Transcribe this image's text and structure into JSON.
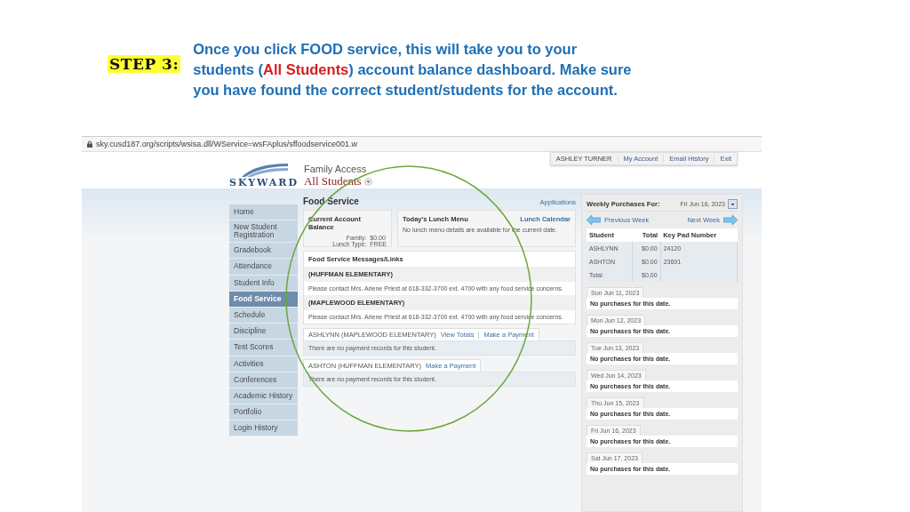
{
  "instruction": {
    "step": "STEP 3:",
    "parts": [
      {
        "text": "Once you click FOOD service, this will take you to your students (",
        "kind": "plain"
      },
      {
        "text": "All Students",
        "kind": "highlight"
      },
      {
        "text": ") account balance dashboard. Make sure you have found the correct student/students for the account.",
        "kind": "plain"
      }
    ]
  },
  "browser": {
    "url": "sky.cusd187.org/scripts/wsisa.dll/WService=wsFAplus/sffoodservice001.w"
  },
  "header": {
    "logo": "SKYWARD",
    "app": "Family Access",
    "student_selector": "All Students",
    "user": "ASHLEY TURNER",
    "links": [
      "My Account",
      "Email History",
      "Exit"
    ]
  },
  "sidebar": {
    "items": [
      {
        "label": "Home",
        "selected": false
      },
      {
        "label": "New Student Registration",
        "selected": false
      },
      {
        "label": "Gradebook",
        "selected": false
      },
      {
        "label": "Attendance",
        "selected": false
      },
      {
        "label": "Student Info",
        "selected": false
      },
      {
        "label": "Food Service",
        "selected": true
      },
      {
        "label": "Schedule",
        "selected": false
      },
      {
        "label": "Discipline",
        "selected": false
      },
      {
        "label": "Test Scores",
        "selected": false
      },
      {
        "label": "Activities",
        "selected": false
      },
      {
        "label": "Conferences",
        "selected": false
      },
      {
        "label": "Academic History",
        "selected": false
      },
      {
        "label": "Portfolio",
        "selected": false
      },
      {
        "label": "Login History",
        "selected": false
      }
    ]
  },
  "main": {
    "title": "Food Service",
    "applications_link": "Applications",
    "balance": {
      "title": "Current Account Balance",
      "lines": [
        {
          "label": "Family:",
          "value": "$0.00"
        },
        {
          "label": "Lunch Type:",
          "value": "FREE"
        }
      ]
    },
    "lunch": {
      "title": "Today's Lunch Menu",
      "link": "Lunch Calendar",
      "text": "No lunch menu details are available for the current date."
    },
    "messages": {
      "title": "Food Service Messages/Links",
      "groups": [
        {
          "school": "(HUFFMAN ELEMENTARY)",
          "message": "Please contact Mrs. Arlene Priest at 618-332-3700 ext. 4700 with any food service concerns."
        },
        {
          "school": "(MAPLEWOOD ELEMENTARY)",
          "message": "Please contact Mrs. Arlene Priest at 618-332-3700 ext. 4700 with any food service concerns."
        }
      ]
    },
    "students": [
      {
        "name": "ASHLYNN (MAPLEWOOD ELEMENTARY)",
        "links": [
          "View Totals",
          "Make a Payment"
        ],
        "message": "There are no payment records for this student."
      },
      {
        "name": "ASHTON (HUFFMAN ELEMENTARY)",
        "links": [
          "Make a Payment"
        ],
        "message": "There are no payment records for this student."
      }
    ]
  },
  "weekly": {
    "title": "Weekly Purchases For:",
    "date": "Fri Jun 16, 2023",
    "previous": "Previous Week",
    "next": "Next Week",
    "columns": [
      "Student",
      "Total",
      "Key Pad Number"
    ],
    "rows": [
      [
        "ASHLYNN",
        "$0.00",
        "24120"
      ],
      [
        "ASHTON",
        "$0.00",
        "23691"
      ],
      [
        "Total",
        "$0.00",
        ""
      ]
    ],
    "days": [
      {
        "date": "Sun Jun 11, 2023",
        "text": "No purchases for this date."
      },
      {
        "date": "Mon Jun 12, 2023",
        "text": "No purchases for this date."
      },
      {
        "date": "Tue Jun 13, 2023",
        "text": "No purchases for this date."
      },
      {
        "date": "Wed Jun 14, 2023",
        "text": "No purchases for this date."
      },
      {
        "date": "Thu Jun 15, 2023",
        "text": "No purchases for this date."
      },
      {
        "date": "Fri Jun 16, 2023",
        "text": "No purchases for this date."
      },
      {
        "date": "Sat Jun 17, 2023",
        "text": "No purchases for this date."
      }
    ]
  }
}
